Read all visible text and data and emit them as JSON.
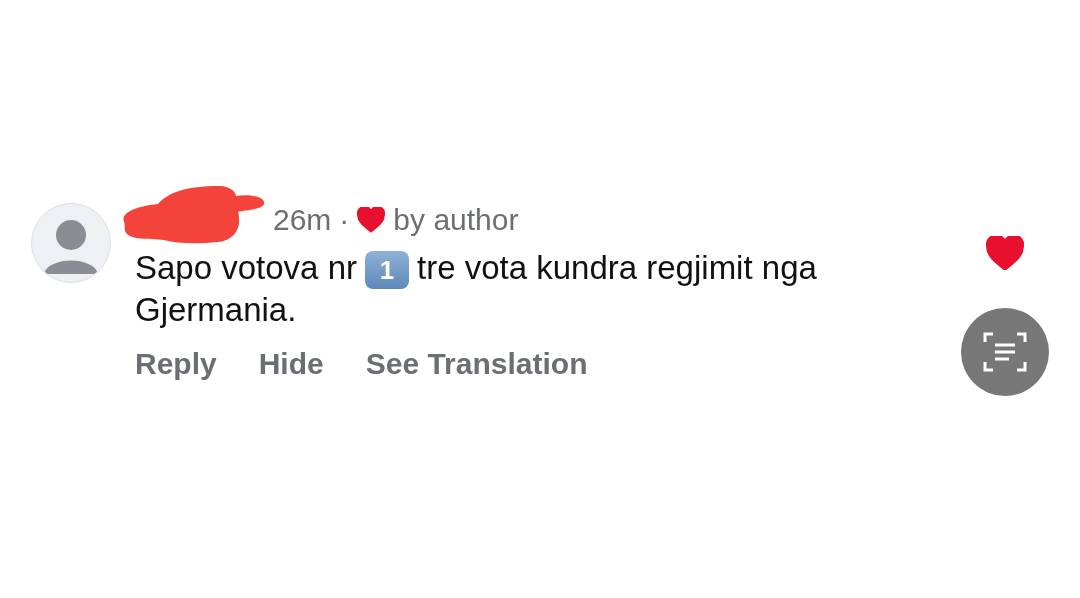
{
  "comment": {
    "time": "26m",
    "separator": "·",
    "liked_by_author": true,
    "author_label": "by author",
    "text_before": "Sapo votova nr",
    "keycap": "1",
    "text_after": "tre vota kundra regjimit nga Gjermania.",
    "actions": [
      "Reply",
      "Hide",
      "See Translation"
    ],
    "liked": true
  }
}
